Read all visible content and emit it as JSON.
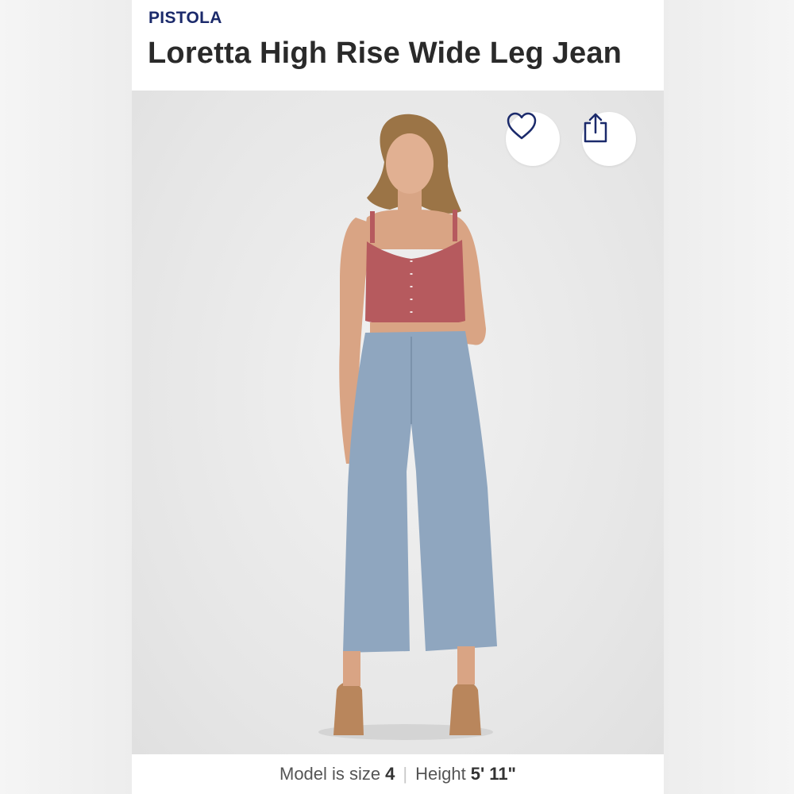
{
  "product": {
    "brand": "PISTOLA",
    "title": "Loretta High Rise Wide Leg Jean"
  },
  "actions": {
    "favorite_icon": "heart-icon",
    "share_icon": "share-icon"
  },
  "model_info": {
    "size_label": "Model is size",
    "size_value": "4",
    "separator": "|",
    "height_label": "Height",
    "height_value": "5' 11\""
  },
  "colors": {
    "brand": "#1b2a6b",
    "title": "#2a2a2a",
    "top": "#b65a5e",
    "denim": "#8fa6bf"
  }
}
